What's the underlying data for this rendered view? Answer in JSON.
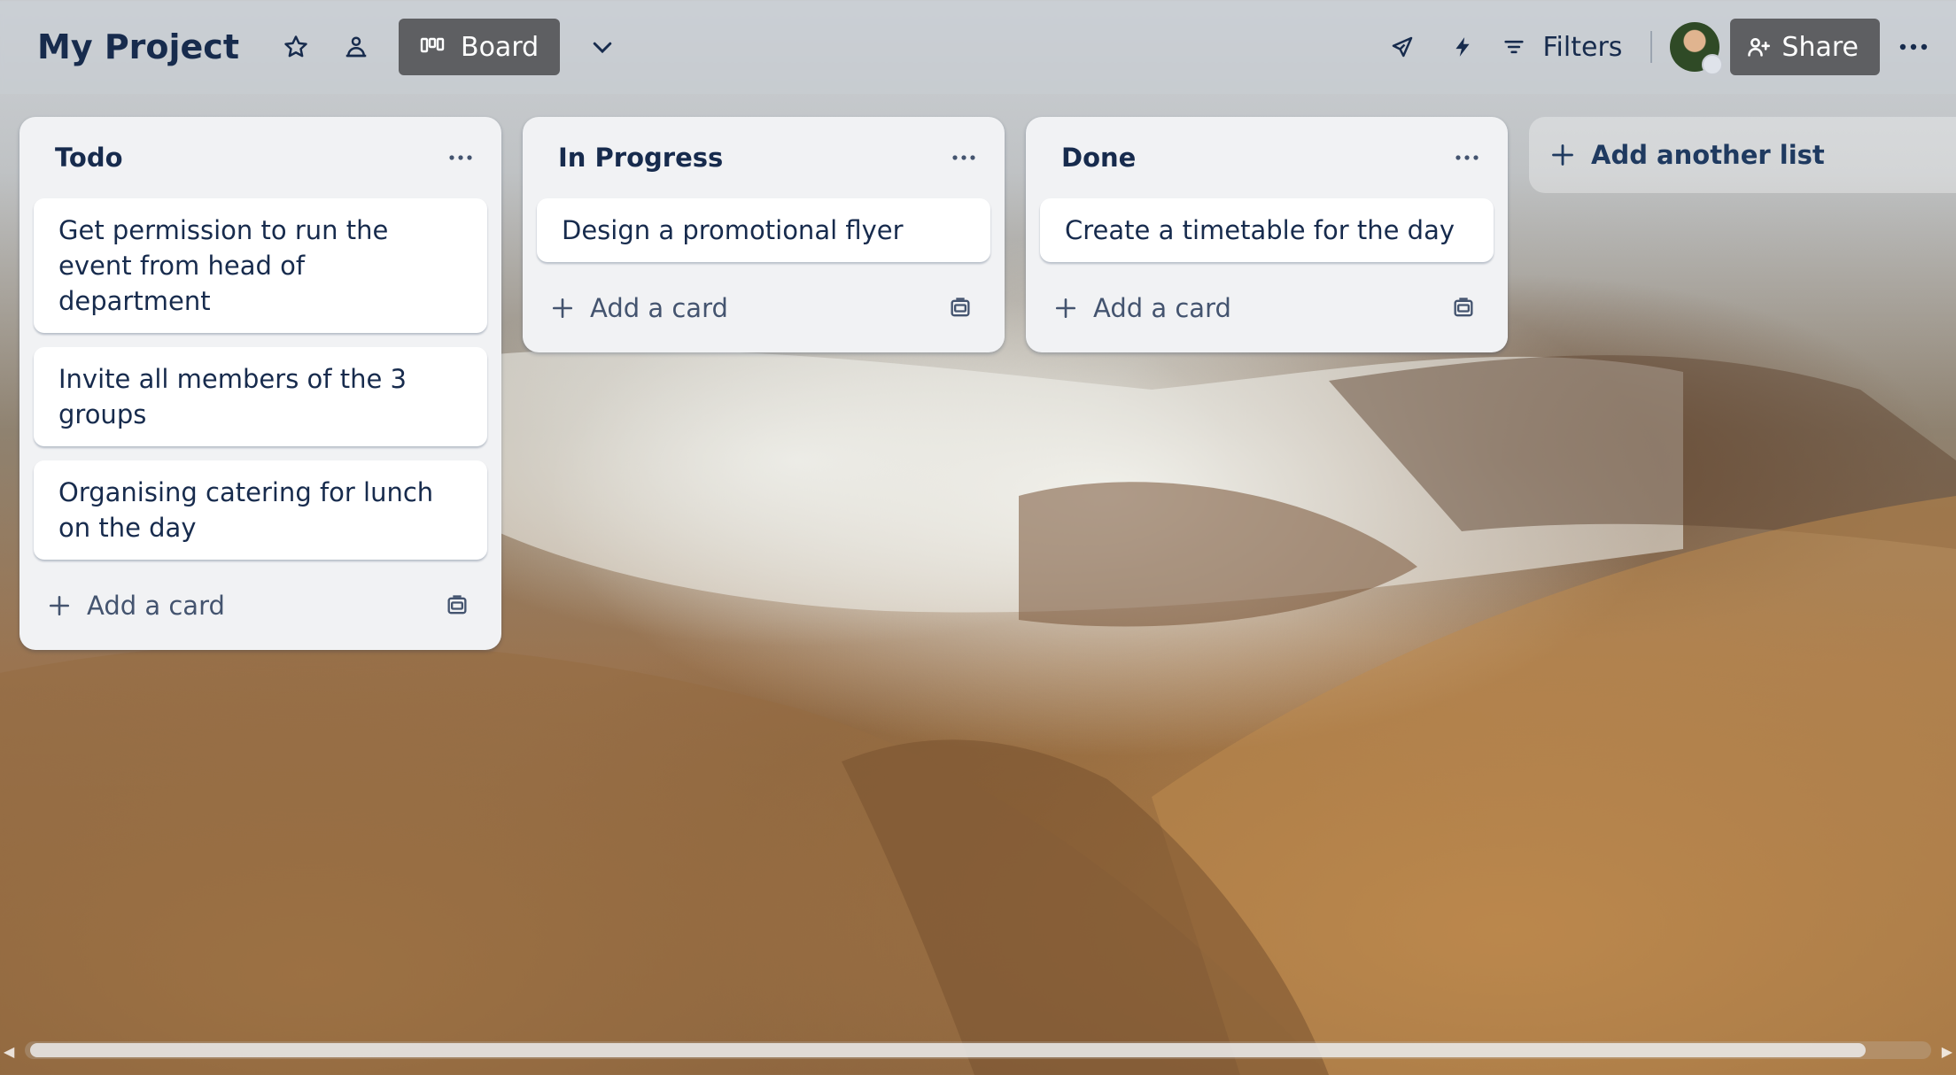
{
  "header": {
    "title": "My Project",
    "view_label": "Board",
    "filters_label": "Filters",
    "share_label": "Share"
  },
  "lists": [
    {
      "title": "Todo",
      "cards": [
        "Get permission to run the event from head of department",
        "Invite all members of the 3 groups",
        "Organising catering for lunch on the day"
      ],
      "add_card_label": "Add a card"
    },
    {
      "title": "In Progress",
      "cards": [
        "Design a promotional flyer"
      ],
      "add_card_label": "Add a card"
    },
    {
      "title": "Done",
      "cards": [
        "Create a timetable for the day"
      ],
      "add_card_label": "Add a card"
    }
  ],
  "add_list_label": "Add another list",
  "icons": {
    "star": "star-icon",
    "workspace": "workspace-visibility-icon",
    "board": "board-icon",
    "view_switch": "chevron-down-icon",
    "power_ups": "rocket-icon",
    "automation": "lightning-icon",
    "filter": "filter-icon",
    "share": "add-person-icon",
    "more": "ellipsis-icon",
    "card_template": "card-template-icon",
    "plus": "plus-icon"
  },
  "colors": {
    "text_primary": "#172b4d",
    "list_bg": "#f1f2f4",
    "button_dark": "#5e5f62"
  }
}
